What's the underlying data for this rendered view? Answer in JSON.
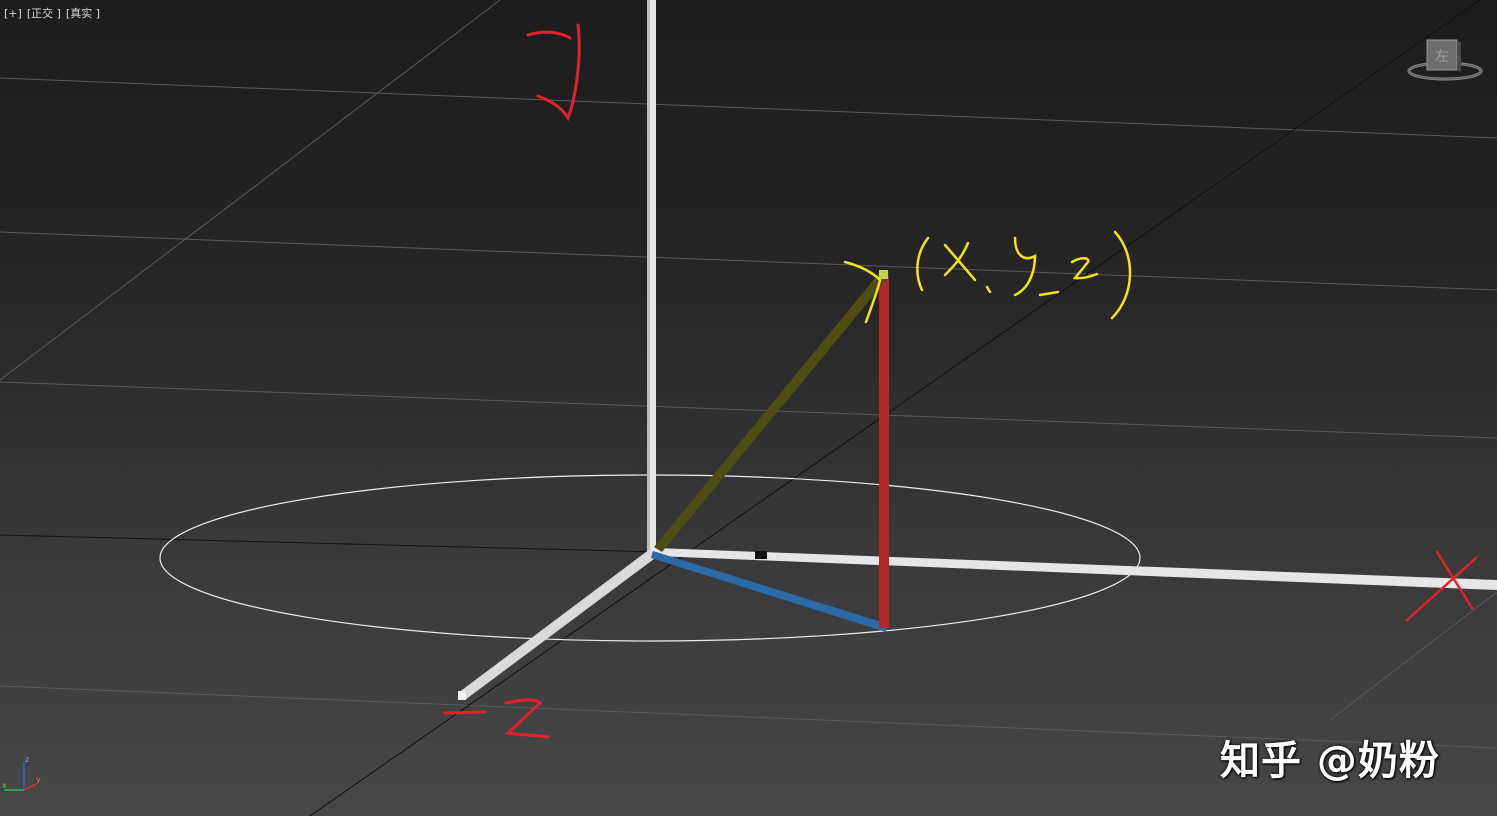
{
  "viewport": {
    "labels": [
      "[+]",
      "[正交 ]",
      "[真实 ]"
    ]
  },
  "annotations": {
    "y_axis": "y",
    "x_axis": "x",
    "z_axis": "-z",
    "point": "(x, y, z)"
  },
  "viewcube": {
    "face_label": "左"
  },
  "triad": {
    "z": "z",
    "x": "x",
    "y": "y"
  },
  "watermark": "知乎 @奶粉",
  "colors": {
    "axis": "#e6e6e6",
    "vector": "#4d4d14",
    "height": "#b5262a",
    "projection": "#2a6aa8",
    "annotation_red": "#e0232b",
    "annotation_yellow": "#f2e21a"
  }
}
